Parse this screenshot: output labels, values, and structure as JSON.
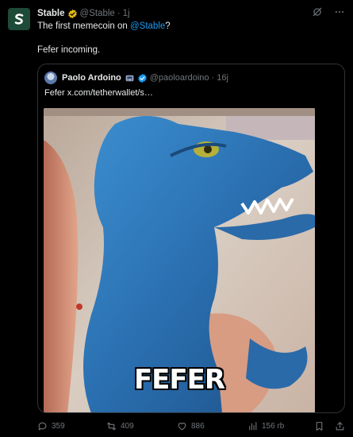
{
  "tweet": {
    "author_name": "Stable",
    "author_handle": "@Stable",
    "time": "1j",
    "text_prefix": "The first memecoin on ",
    "mention": "@Stable",
    "text_suffix": "?",
    "text2": "Fefer incoming."
  },
  "quote": {
    "author_name": "Paolo Ardoino",
    "author_handle": "@paoloardoino",
    "time": "16j",
    "text": "Fefer  x.com/tetherwallet/s…",
    "image_caption": "FEFER"
  },
  "actions": {
    "replies": "359",
    "reposts": "409",
    "likes": "886",
    "views": "156 rb"
  },
  "colors": {
    "background": "#000000",
    "accent": "#1d9bf0",
    "muted": "#71767b",
    "verified_gold": "#e2b719",
    "avatar_green": "#1e4a39"
  }
}
